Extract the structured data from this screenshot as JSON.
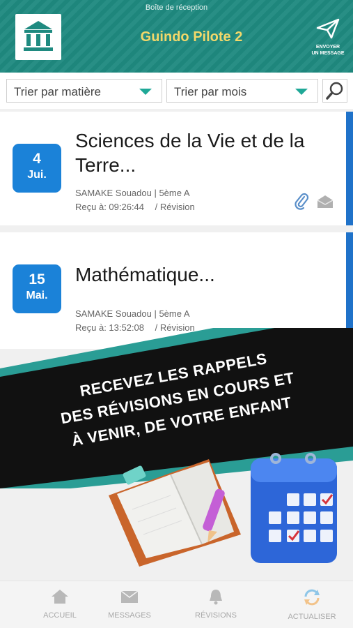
{
  "header": {
    "status_title": "Boîte de réception",
    "app_title": "Guindo Pilote 2",
    "send_label_line1": "ENVOYER",
    "send_label_line2": "UN MESSAGE"
  },
  "filters": {
    "subject": "Trier par matière",
    "month": "Trier par mois"
  },
  "messages": [
    {
      "day": "4",
      "month": "Jui.",
      "title_line1": "Sciences de la Vie et de la",
      "title_line2": "Terre...",
      "sender": "SAMAKE Souadou | 5ème A",
      "received": "Reçu à:  09:26:44",
      "type": "/  Révision"
    },
    {
      "day": "15",
      "month": "Mai.",
      "title_line1": "Mathématique...",
      "sender": "SAMAKE Souadou | 5ème A",
      "received": "Reçu à:  13:52:08",
      "type": "/  Révision"
    }
  ],
  "promo": {
    "line1": "RECEVEZ LES RAPPELS",
    "line2": "DES RÉVISIONS EN COURS ET",
    "line3": "À VENIR, DE VOTRE ENFANT"
  },
  "nav": {
    "home": "ACCUEIL",
    "messages": "MESSAGES",
    "revisions": "RÉVISIONS",
    "refresh": "ACTUALISER"
  },
  "colors": {
    "header_teal": "#1f8a80",
    "title_yellow": "#f3d86a",
    "badge_blue": "#1b82d8",
    "accent_blue": "#1f72c9",
    "banner_black": "#111111"
  },
  "icons": [
    "bank-logo-icon",
    "paper-plane-icon",
    "search-icon",
    "paperclip-icon",
    "envelope-icon",
    "home-icon",
    "mail-icon",
    "bell-icon",
    "refresh-icon"
  ]
}
